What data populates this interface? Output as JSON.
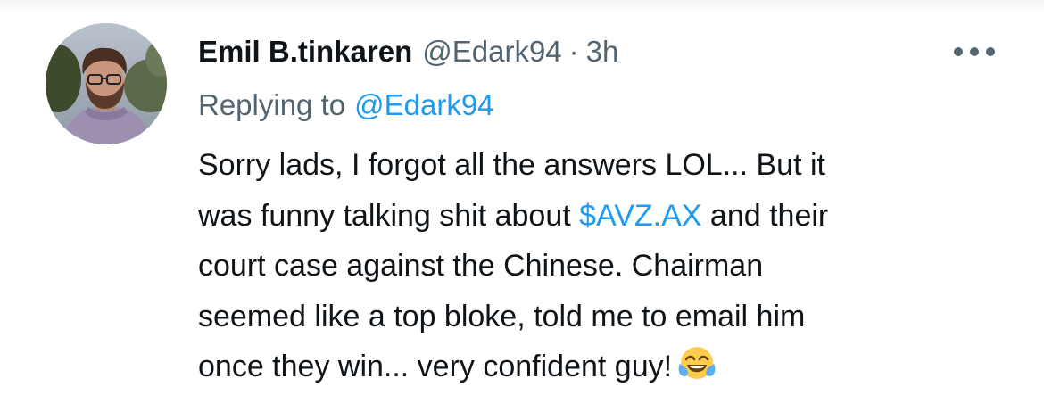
{
  "tweet": {
    "author": {
      "display_name": "Emil B.tinkaren",
      "handle": "@Edark94",
      "avatar_icon": "user-photo-avatar"
    },
    "separator": "·",
    "timestamp": "3h",
    "more_icon": "more-horizontal-icon",
    "reply_label": "Replying to",
    "reply_handle": "@Edark94",
    "lines": {
      "line1": "Sorry lads, I forgot all the answers LOL... But it",
      "line2_pre": "was funny talking shit about ",
      "line2_cashtag": "$AVZ.AX",
      "line2_post": " and their",
      "line3": "court case against the Chinese. Chairman",
      "line4": "seemed like a top bloke, told me to email him",
      "line5": "once they win... very confident guy!"
    },
    "emoji_icon": "tears-of-joy-emoji-icon",
    "colors": {
      "text": "#0f1419",
      "secondary": "#536471",
      "link": "#1d9bf0"
    }
  }
}
